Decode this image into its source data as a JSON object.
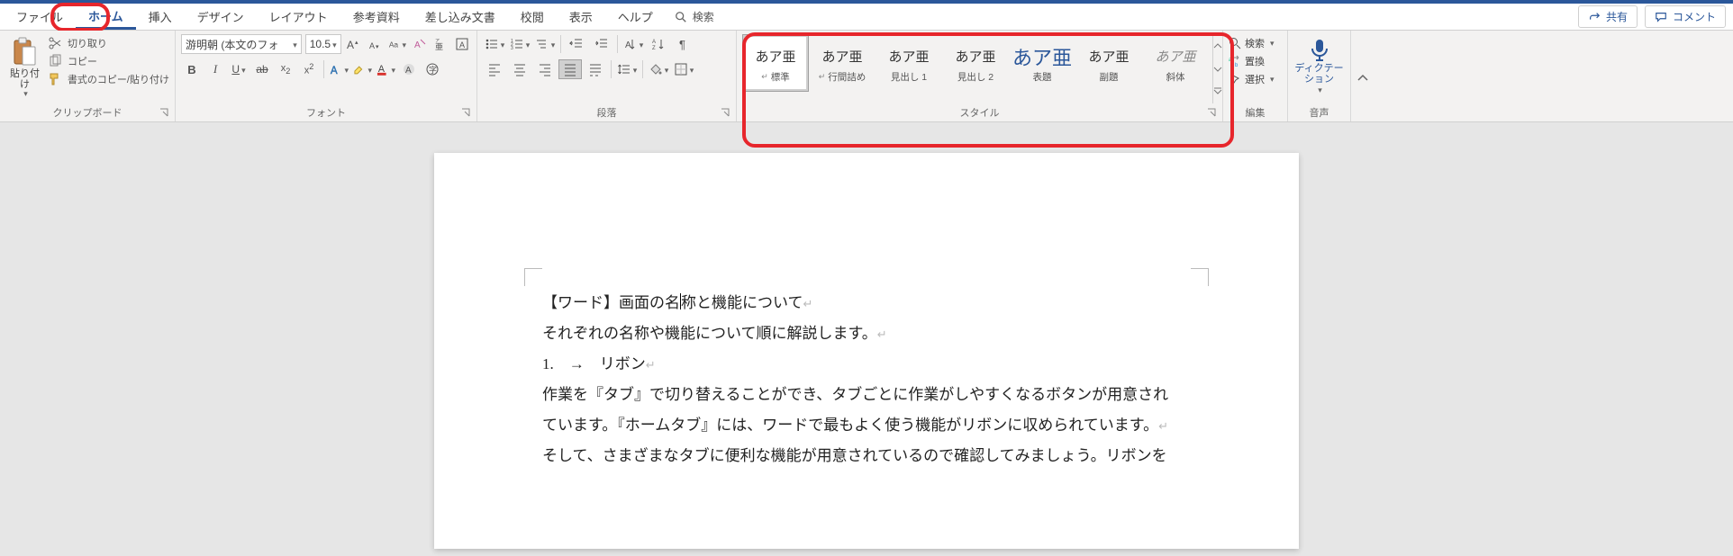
{
  "tabs": {
    "file": "ファイル",
    "home": "ホーム",
    "insert": "挿入",
    "design": "デザイン",
    "layout": "レイアウト",
    "references": "参考資料",
    "mailings": "差し込み文書",
    "review": "校閲",
    "view": "表示",
    "help": "ヘルプ"
  },
  "search": {
    "placeholder": "検索"
  },
  "titlebar": {
    "share": "共有",
    "comments": "コメント"
  },
  "clipboard": {
    "paste": "貼り付け",
    "cut": "切り取り",
    "copy": "コピー",
    "format_painter": "書式のコピー/貼り付け",
    "group_label": "クリップボード"
  },
  "font": {
    "name": "游明朝 (本文のフォ",
    "size": "10.5",
    "group_label": "フォント"
  },
  "paragraph": {
    "group_label": "段落"
  },
  "styles": {
    "sample": "あア亜",
    "items": [
      {
        "name": "標準",
        "marker": true
      },
      {
        "name": "行間詰め",
        "marker": true
      },
      {
        "name": "見出し 1"
      },
      {
        "name": "見出し 2"
      },
      {
        "name": "表題",
        "big": true
      },
      {
        "name": "副題"
      },
      {
        "name": "斜体",
        "italic": true
      }
    ],
    "group_label": "スタイル"
  },
  "editing": {
    "find": "検索",
    "replace": "置換",
    "select": "選択",
    "group_label": "編集"
  },
  "voice": {
    "dictate": "ディクテーション",
    "group_label": "音声"
  },
  "document": {
    "lines": [
      "【ワード】画面の名称と機能について",
      "それぞれの名称や機能について順に解説します。",
      "1.　→　リボン",
      "作業を『タブ』で切り替えることができ、タブごとに作業がしやすくなるボタンが用意され",
      "ています。『ホームタブ』には、ワードで最もよく使う機能がリボンに収められています。",
      "そして、さまざまなタブに便利な機能が用意されているので確認してみましょう。リボンを"
    ],
    "caret_line": 0,
    "caret_char_before": "【ワード】画面の名",
    "caret_char_after": "称と機能について"
  }
}
